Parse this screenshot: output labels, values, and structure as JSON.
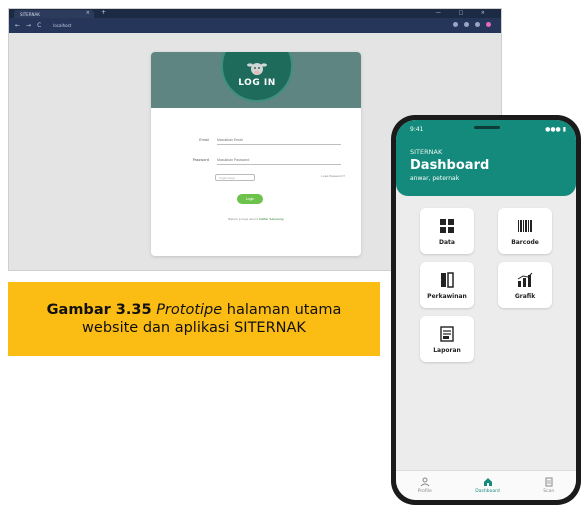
{
  "browser": {
    "tab_title": "SITERNAK",
    "tab_close": "×",
    "tab_new": "+",
    "window_controls": "— □ ×",
    "url": "localhost",
    "nav_back": "←",
    "nav_forward": "→",
    "nav_reload": "C"
  },
  "login": {
    "title": "LOG IN",
    "email_label": "Email",
    "email_placeholder": "Masukkan Email",
    "password_label": "Password",
    "password_placeholder": "Masukkan Password",
    "remember_label": "Ingat Saya",
    "forgot_link": "Lupa Password?",
    "login_button": "Login",
    "register_text": "Belum punya akun?",
    "register_link": "Daftar Sekarang"
  },
  "caption": {
    "bold": "Gambar 3.35",
    "italic": "Prototipe",
    "rest": " halaman utama website dan aplikasi SITERNAK"
  },
  "phone": {
    "status_time": "9:41",
    "status_right": "●●● ▮",
    "app_name": "SITERNAK",
    "title": "Dashboard",
    "subtitle": "anwar, peternak",
    "menu": [
      {
        "label": "Data",
        "icon": "grid-icon"
      },
      {
        "label": "Barcode",
        "icon": "barcode-icon"
      },
      {
        "label": "Perkawinan",
        "icon": "door-icon"
      },
      {
        "label": "Grafik",
        "icon": "chart-icon"
      },
      {
        "label": "Laporan",
        "icon": "report-icon"
      }
    ],
    "nav": [
      {
        "label": "Profile",
        "icon": "profile-icon"
      },
      {
        "label": "Dashboard",
        "icon": "home-icon"
      },
      {
        "label": "Scan",
        "icon": "scan-icon"
      }
    ]
  },
  "colors": {
    "teal": "#148a7c",
    "caption_bg": "#fbbc13",
    "login_header": "#5f8583",
    "login_button": "#6cc24a"
  }
}
